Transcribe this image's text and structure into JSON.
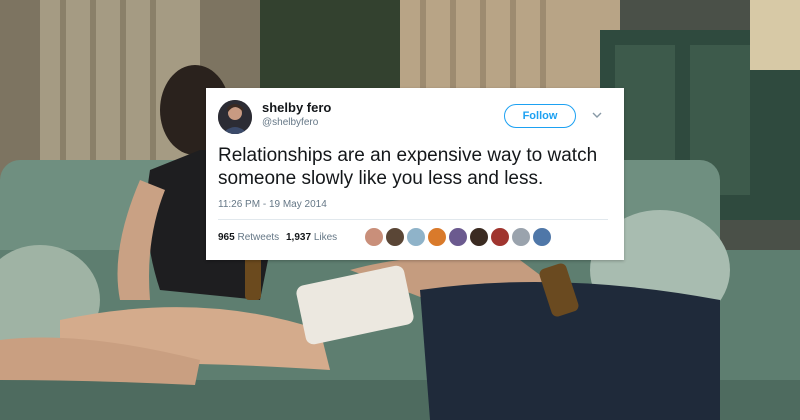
{
  "tweet": {
    "display_name": "shelby fero",
    "handle": "@shelbyfero",
    "follow_label": "Follow",
    "text": "Relationships are an expensive way to watch someone slowly like you less and less.",
    "timestamp": "11:26 PM - 19 May 2014",
    "retweets_count": "965",
    "retweets_label": "Retweets",
    "likes_count": "1,937",
    "likes_label": "Likes"
  },
  "likers": [
    {
      "color": "#c98f7a"
    },
    {
      "color": "#5a4636"
    },
    {
      "color": "#8fb3c9"
    },
    {
      "color": "#d97a2b"
    },
    {
      "color": "#6b5a8f"
    },
    {
      "color": "#3b2b22"
    },
    {
      "color": "#a0352f"
    },
    {
      "color": "#9aa3ad"
    },
    {
      "color": "#4f77a8"
    }
  ],
  "colors": {
    "accent": "#1da1f2",
    "text": "#14171a",
    "secondary_text": "#657786"
  }
}
